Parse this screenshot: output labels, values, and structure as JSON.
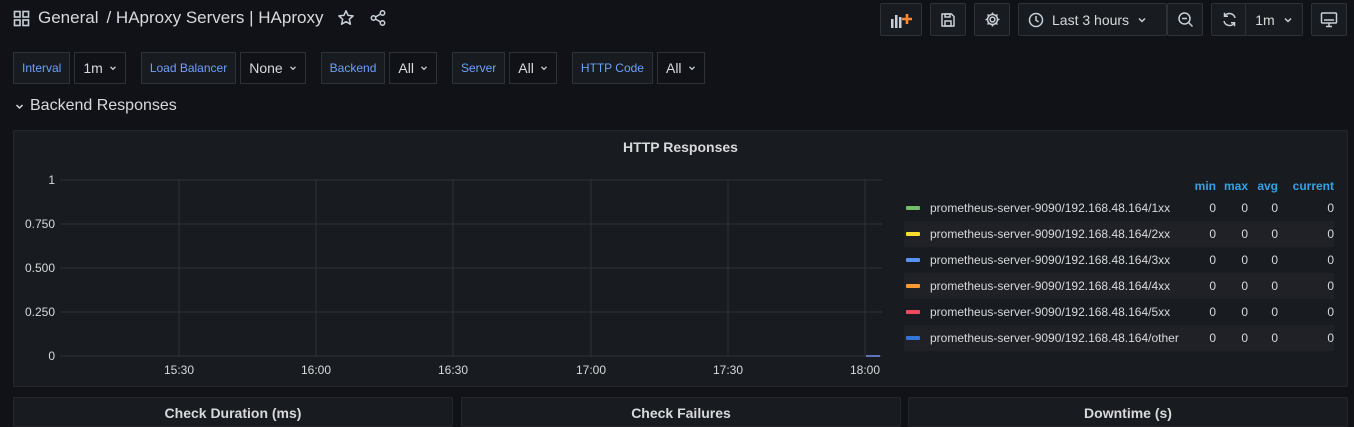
{
  "breadcrumb": {
    "folder": "General",
    "dashboard": "/ HAproxy Servers | HAproxy"
  },
  "toolbar": {
    "time_range": "Last 3 hours",
    "refresh_interval": "1m"
  },
  "variables": [
    {
      "label": "Interval",
      "value": "1m"
    },
    {
      "label": "Load Balancer",
      "value": "None"
    },
    {
      "label": "Backend",
      "value": "All"
    },
    {
      "label": "Server",
      "value": "All"
    },
    {
      "label": "HTTP Code",
      "value": "All"
    }
  ],
  "row": {
    "title": "Backend Responses"
  },
  "panel": {
    "title": "HTTP Responses",
    "legend_columns": [
      "min",
      "max",
      "avg",
      "current"
    ],
    "legend": [
      {
        "name": "prometheus-server-9090/192.168.48.164/1xx",
        "color": "#73bf69",
        "min": "0",
        "max": "0",
        "avg": "0",
        "current": "0"
      },
      {
        "name": "prometheus-server-9090/192.168.48.164/2xx",
        "color": "#fade2a",
        "min": "0",
        "max": "0",
        "avg": "0",
        "current": "0"
      },
      {
        "name": "prometheus-server-9090/192.168.48.164/3xx",
        "color": "#5794f2",
        "min": "0",
        "max": "0",
        "avg": "0",
        "current": "0"
      },
      {
        "name": "prometheus-server-9090/192.168.48.164/4xx",
        "color": "#ff9830",
        "min": "0",
        "max": "0",
        "avg": "0",
        "current": "0"
      },
      {
        "name": "prometheus-server-9090/192.168.48.164/5xx",
        "color": "#f2495c",
        "min": "0",
        "max": "0",
        "avg": "0",
        "current": "0"
      },
      {
        "name": "prometheus-server-9090/192.168.48.164/other",
        "color": "#3274d9",
        "min": "0",
        "max": "0",
        "avg": "0",
        "current": "0"
      }
    ]
  },
  "chart_data": {
    "type": "line",
    "title": "HTTP Responses",
    "x_ticks": [
      "15:30",
      "16:00",
      "16:30",
      "17:00",
      "17:30",
      "18:00"
    ],
    "y_ticks": [
      "1",
      "0.750",
      "0.500",
      "0.250",
      "0"
    ],
    "ylim": [
      0,
      1
    ],
    "grid": true,
    "legend_position": "right"
  },
  "bottom_panels": [
    "Check Duration (ms)",
    "Check Failures",
    "Downtime (s)"
  ]
}
